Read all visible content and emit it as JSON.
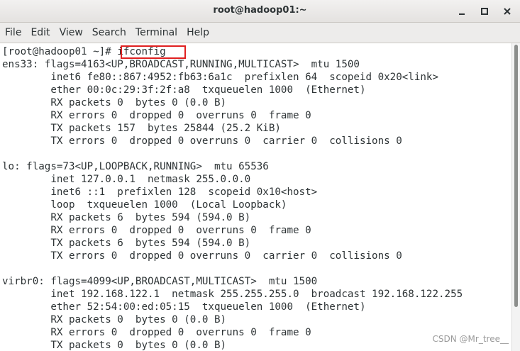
{
  "window": {
    "title": "root@hadoop01:~"
  },
  "title_buttons": {
    "minimize_icon": "minimize-icon",
    "maximize_icon": "maximize-icon",
    "close_icon": "close-icon"
  },
  "menubar": {
    "items": [
      "File",
      "Edit",
      "View",
      "Search",
      "Terminal",
      "Help"
    ]
  },
  "terminal": {
    "lines": [
      "[root@hadoop01 ~]# ifconfig",
      "ens33: flags=4163<UP,BROADCAST,RUNNING,MULTICAST>  mtu 1500",
      "        inet6 fe80::867:4952:fb63:6a1c  prefixlen 64  scopeid 0x20<link>",
      "        ether 00:0c:29:3f:2f:a8  txqueuelen 1000  (Ethernet)",
      "        RX packets 0  bytes 0 (0.0 B)",
      "        RX errors 0  dropped 0  overruns 0  frame 0",
      "        TX packets 157  bytes 25844 (25.2 KiB)",
      "        TX errors 0  dropped 0 overruns 0  carrier 0  collisions 0",
      "",
      "lo: flags=73<UP,LOOPBACK,RUNNING>  mtu 65536",
      "        inet 127.0.0.1  netmask 255.0.0.0",
      "        inet6 ::1  prefixlen 128  scopeid 0x10<host>",
      "        loop  txqueuelen 1000  (Local Loopback)",
      "        RX packets 6  bytes 594 (594.0 B)",
      "        RX errors 0  dropped 0  overruns 0  frame 0",
      "        TX packets 6  bytes 594 (594.0 B)",
      "        TX errors 0  dropped 0 overruns 0  carrier 0  collisions 0",
      "",
      "virbr0: flags=4099<UP,BROADCAST,MULTICAST>  mtu 1500",
      "        inet 192.168.122.1  netmask 255.255.255.0  broadcast 192.168.122.255",
      "        ether 52:54:00:ed:05:15  txqueuelen 1000  (Ethernet)",
      "        RX packets 0  bytes 0 (0.0 B)",
      "        RX errors 0  dropped 0  overruns 0  frame 0",
      "        TX packets 0  bytes 0 (0.0 B)"
    ]
  },
  "watermark": "CSDN @Mr_tree__",
  "colors": {
    "highlight_box": "#e02020",
    "terminal_text": "#2e3436",
    "terminal_bg": "#ffffff"
  }
}
